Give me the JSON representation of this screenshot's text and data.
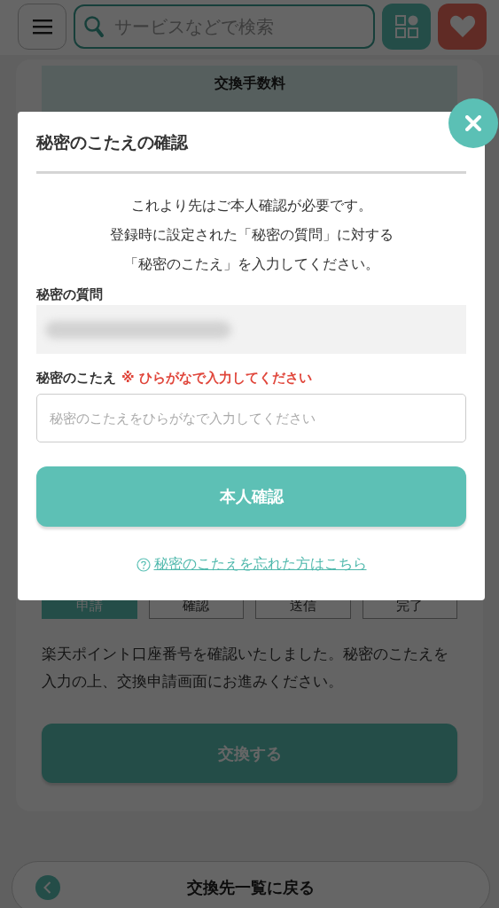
{
  "header": {
    "search": {
      "placeholder": "サービスなどで検索"
    }
  },
  "card": {
    "fee_heading": "交換手数料",
    "steps": [
      {
        "label": "申請",
        "selected": true
      },
      {
        "label": "確認",
        "selected": false
      },
      {
        "label": "送信",
        "selected": false
      },
      {
        "label": "完了",
        "selected": false
      }
    ],
    "message": "楽天ポイント口座番号を確認いたしました。秘密のこたえを入力の上、交換申請画面にお進みください。",
    "submit": {
      "label": "交換する",
      "disabled": true
    }
  },
  "back_button": "交換先一覧に戻る",
  "dialog": {
    "title": "秘密のこたえの確認",
    "intro": [
      "これより先はご本人確認が必要です。",
      "登録時に設定された「秘密の質問」に対する",
      "「秘密のこたえ」を入力してください。"
    ],
    "question_label": "秘密の質問",
    "answer_label": "秘密のこたえ",
    "answer_note": "※ ひらがなで入力してください",
    "answer": {
      "placeholder": "秘密のこたえをひらがなで入力してください"
    },
    "confirm_button": "本人確認",
    "help_link": "秘密のこたえを忘れた方はこちら"
  }
}
